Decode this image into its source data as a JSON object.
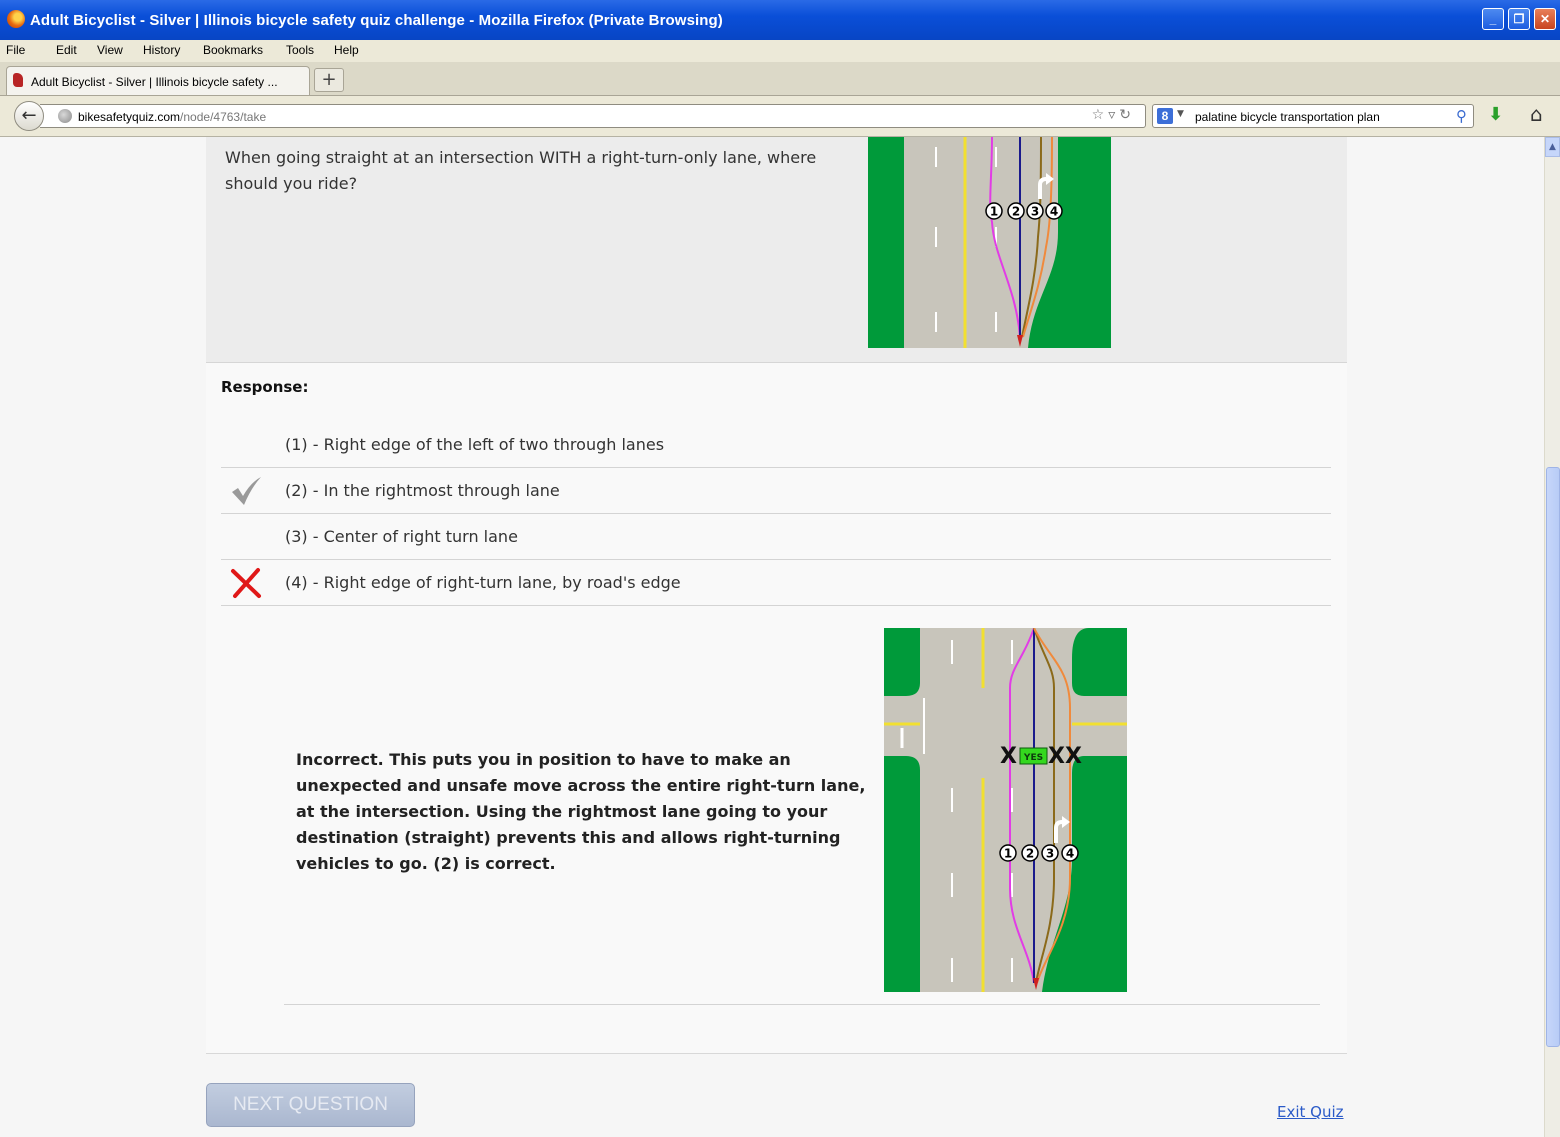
{
  "window": {
    "title": "Adult Bicyclist - Silver | Illinois bicycle safety quiz challenge - Mozilla Firefox (Private Browsing)",
    "minimize": "_",
    "restore": "❐",
    "close": "✕"
  },
  "menu": [
    "File",
    "Edit",
    "View",
    "History",
    "Bookmarks",
    "Tools",
    "Help"
  ],
  "tab": {
    "label": "Adult Bicyclist - Silver | Illinois bicycle safety ...",
    "new_tab": "+"
  },
  "nav": {
    "url_host": "bikesafetyquiz.com",
    "url_path": "/node/4763/take",
    "search_engine_icon": "8",
    "search_query": "palatine bicycle transportation plan"
  },
  "question": {
    "text": "When going straight at an intersection WITH a right-turn-only lane, where should you ride?",
    "diagram_markers": [
      "1",
      "2",
      "3",
      "4"
    ]
  },
  "response": {
    "label": "Response:",
    "answers": [
      {
        "text": "(1) - Right edge of the left of two through lanes",
        "mark": "none"
      },
      {
        "text": "(2) - In the rightmost through lane",
        "mark": "correct"
      },
      {
        "text": "(3) - Center of right turn lane",
        "mark": "none"
      },
      {
        "text": "(4) - Right edge of right-turn lane, by road's edge",
        "mark": "incorrect"
      }
    ],
    "feedback": "Incorrect.  This puts you in position to have to make an unexpected and unsafe move across the entire right-turn lane, at the intersection.  Using the rightmost lane going to your destination (straight) prevents this and allows right-turning vehicles to go.  (2) is correct.",
    "feedback_diagram": {
      "markers": [
        "1",
        "2",
        "3",
        "4"
      ],
      "x_mark": "X",
      "yes_tag": "YES",
      "xx_mark": "XX"
    }
  },
  "footer": {
    "next_button": "NEXT QUESTION",
    "exit_link": "Exit Quiz"
  },
  "colors": {
    "grass": "#009a3a",
    "road": "#c8c5bb",
    "yellow_line": "#f2e030",
    "path1": "#e23ce6",
    "path2": "#1a1a8c",
    "path3": "#8b6a1a",
    "path4": "#f08a3c"
  }
}
